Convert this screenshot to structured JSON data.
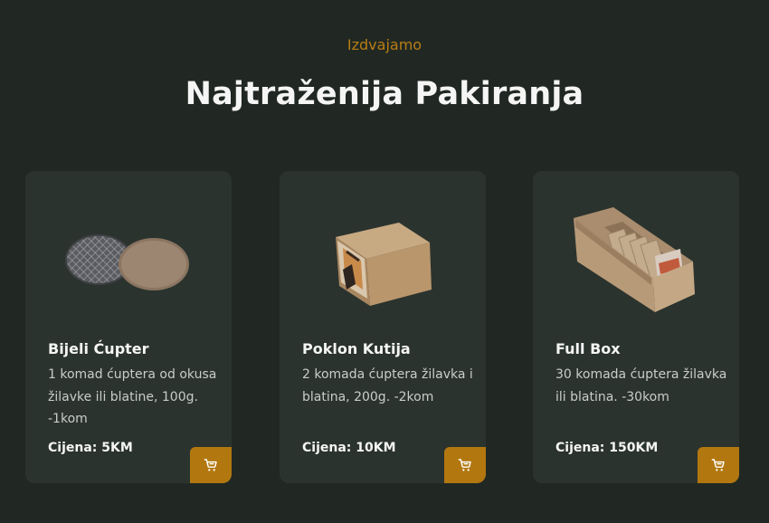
{
  "section": {
    "eyebrow": "Izdvajamo",
    "title": "Najtraženija Pakiranja"
  },
  "products": [
    {
      "name": "Bijeli Ćupter",
      "description": "1 komad ćuptera od okusa žilavke ili blatine, 100g. -1kom",
      "price": "Cijena: 5KM",
      "image_icon": "round-wafers-image"
    },
    {
      "name": "Poklon Kutija",
      "description": "2 komada ćuptera žilavka i blatina, 200g. -2kom",
      "price": "Cijena: 10KM",
      "image_icon": "gift-box-image"
    },
    {
      "name": "Full Box",
      "description": "30 komada ćuptera žilavka ili blatina. -30kom",
      "price": "Cijena: 150KM",
      "image_icon": "open-box-image"
    }
  ],
  "colors": {
    "background": "#212823",
    "card": "#2b332e",
    "accent": "#b2770f"
  },
  "cart_icon": "cart-icon"
}
